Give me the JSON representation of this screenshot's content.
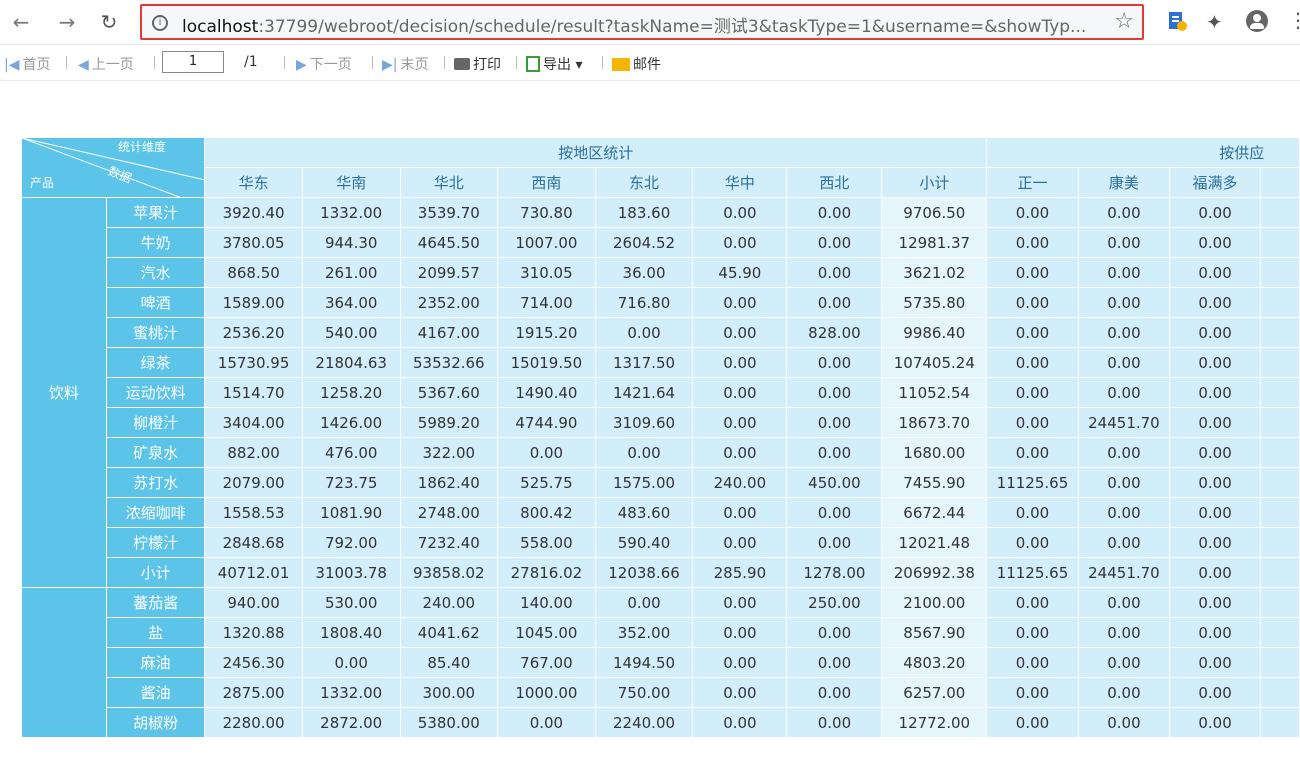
{
  "browser": {
    "url_host": "localhost",
    "url_rest": ":37799/webroot/decision/schedule/result?taskName=测试3&taskType=1&username=&showTyp..."
  },
  "toolbar": {
    "first": "首页",
    "prev": "上一页",
    "page_value": "1",
    "page_total": "/1",
    "next": "下一页",
    "last": "末页",
    "print": "打印",
    "export": "导出",
    "mail": "邮件"
  },
  "table": {
    "corner": {
      "dimension": "统计维度",
      "data": "数据",
      "product": "产品"
    },
    "group_region": "按地区统计",
    "group_supplier": "按供应",
    "columns": [
      "华东",
      "华南",
      "华北",
      "西南",
      "东北",
      "华中",
      "西北",
      "小计",
      "正一",
      "康美",
      "福满多"
    ],
    "category1": "饮料",
    "rows": [
      {
        "name": "苹果汁",
        "values": [
          "3920.40",
          "1332.00",
          "3539.70",
          "730.80",
          "183.60",
          "0.00",
          "0.00",
          "9706.50",
          "0.00",
          "0.00",
          "0.00"
        ]
      },
      {
        "name": "牛奶",
        "values": [
          "3780.05",
          "944.30",
          "4645.50",
          "1007.00",
          "2604.52",
          "0.00",
          "0.00",
          "12981.37",
          "0.00",
          "0.00",
          "0.00"
        ]
      },
      {
        "name": "汽水",
        "values": [
          "868.50",
          "261.00",
          "2099.57",
          "310.05",
          "36.00",
          "45.90",
          "0.00",
          "3621.02",
          "0.00",
          "0.00",
          "0.00"
        ]
      },
      {
        "name": "啤酒",
        "values": [
          "1589.00",
          "364.00",
          "2352.00",
          "714.00",
          "716.80",
          "0.00",
          "0.00",
          "5735.80",
          "0.00",
          "0.00",
          "0.00"
        ]
      },
      {
        "name": "蜜桃汁",
        "values": [
          "2536.20",
          "540.00",
          "4167.00",
          "1915.20",
          "0.00",
          "0.00",
          "828.00",
          "9986.40",
          "0.00",
          "0.00",
          "0.00"
        ]
      },
      {
        "name": "绿茶",
        "values": [
          "15730.95",
          "21804.63",
          "53532.66",
          "15019.50",
          "1317.50",
          "0.00",
          "0.00",
          "107405.24",
          "0.00",
          "0.00",
          "0.00"
        ]
      },
      {
        "name": "运动饮料",
        "values": [
          "1514.70",
          "1258.20",
          "5367.60",
          "1490.40",
          "1421.64",
          "0.00",
          "0.00",
          "11052.54",
          "0.00",
          "0.00",
          "0.00"
        ]
      },
      {
        "name": "柳橙汁",
        "values": [
          "3404.00",
          "1426.00",
          "5989.20",
          "4744.90",
          "3109.60",
          "0.00",
          "0.00",
          "18673.70",
          "0.00",
          "24451.70",
          "0.00"
        ]
      },
      {
        "name": "矿泉水",
        "values": [
          "882.00",
          "476.00",
          "322.00",
          "0.00",
          "0.00",
          "0.00",
          "0.00",
          "1680.00",
          "0.00",
          "0.00",
          "0.00"
        ]
      },
      {
        "name": "苏打水",
        "values": [
          "2079.00",
          "723.75",
          "1862.40",
          "525.75",
          "1575.00",
          "240.00",
          "450.00",
          "7455.90",
          "11125.65",
          "0.00",
          "0.00"
        ]
      },
      {
        "name": "浓缩咖啡",
        "values": [
          "1558.53",
          "1081.90",
          "2748.00",
          "800.42",
          "483.60",
          "0.00",
          "0.00",
          "6672.44",
          "0.00",
          "0.00",
          "0.00"
        ]
      },
      {
        "name": "柠檬汁",
        "values": [
          "2848.68",
          "792.00",
          "7232.40",
          "558.00",
          "590.40",
          "0.00",
          "0.00",
          "12021.48",
          "0.00",
          "0.00",
          "0.00"
        ]
      },
      {
        "name": "小计",
        "values": [
          "40712.01",
          "31003.78",
          "93858.02",
          "27816.02",
          "12038.66",
          "285.90",
          "1278.00",
          "206992.38",
          "11125.65",
          "24451.70",
          "0.00"
        ]
      }
    ],
    "category2": "",
    "rows2": [
      {
        "name": "蕃茄酱",
        "values": [
          "940.00",
          "530.00",
          "240.00",
          "140.00",
          "0.00",
          "0.00",
          "250.00",
          "2100.00",
          "0.00",
          "0.00",
          "0.00"
        ]
      },
      {
        "name": "盐",
        "values": [
          "1320.88",
          "1808.40",
          "4041.62",
          "1045.00",
          "352.00",
          "0.00",
          "0.00",
          "8567.90",
          "0.00",
          "0.00",
          "0.00"
        ]
      },
      {
        "name": "麻油",
        "values": [
          "2456.30",
          "0.00",
          "85.40",
          "767.00",
          "1494.50",
          "0.00",
          "0.00",
          "4803.20",
          "0.00",
          "0.00",
          "0.00"
        ]
      },
      {
        "name": "酱油",
        "values": [
          "2875.00",
          "1332.00",
          "300.00",
          "1000.00",
          "750.00",
          "0.00",
          "0.00",
          "6257.00",
          "0.00",
          "0.00",
          "0.00"
        ]
      },
      {
        "name": "胡椒粉",
        "values": [
          "2280.00",
          "2872.00",
          "5380.00",
          "0.00",
          "2240.00",
          "0.00",
          "0.00",
          "12772.00",
          "0.00",
          "0.00",
          "0.00"
        ]
      }
    ]
  }
}
